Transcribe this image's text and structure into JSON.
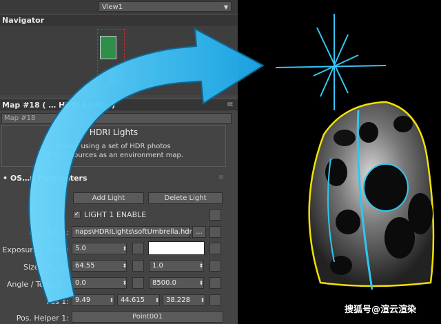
{
  "viewport_select": {
    "value": "View1"
  },
  "navigator": {
    "title": "Navigator"
  },
  "map_panel": {
    "title": "Map #18  ( … HDRI Lights )",
    "name_field": "Map #18",
    "plugin_title": "HDRI Lights",
    "description_line1": "Allows using a set of HDR photos",
    "description_line2": "of light sources as an environment map."
  },
  "parameters": {
    "section_title": "OS…p Parameters",
    "add_light": "Add Light",
    "delete_light": "Delete Light",
    "enable_label": "LIGHT 1 ENABLE",
    "file_label": "L… FILE 1:",
    "file_value": "naps\\HDRILights\\softUmbrella.hdr",
    "browse": "...",
    "exposure_label": "Exposure / Tint 1:",
    "exposure_value": "5.0",
    "size_label": "Size / A… 1:",
    "size_value": "64.55",
    "size_value2": "1.0",
    "angle_label": "Angle / Temp (…",
    "angle_value": "0.0",
    "temp_value": "8500.0",
    "pos_label": "Pos 1:",
    "pos_x": "9.49",
    "pos_y": "44.615",
    "pos_z": "38.228",
    "helper_label": "Pos. Helper 1:",
    "helper_value": "Point001"
  },
  "watermark": "搜狐号@渲云渲染",
  "colors": {
    "accent_blue": "#2ec8f0",
    "panel_bg": "#444444",
    "highlight_yellow": "#f5e100"
  }
}
